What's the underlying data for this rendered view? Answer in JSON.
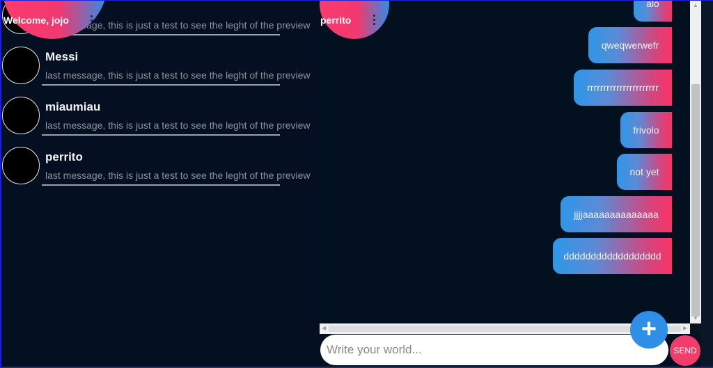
{
  "sidebar": {
    "welcome": "Welcome, jojo",
    "contacts": [
      {
        "name": "",
        "preview": "last message, this is just a test to see the leght of the preview"
      },
      {
        "name": "Messi",
        "preview": "last message, this is just a test to see the leght of the preview"
      },
      {
        "name": "miaumiau",
        "preview": "last message, this is just a test to see the leght of the preview"
      },
      {
        "name": "perrito",
        "preview": "last message, this is just a test to see the leght of the preview"
      }
    ]
  },
  "chat": {
    "title": "perrito",
    "messages": [
      {
        "text": "alo"
      },
      {
        "text": "qweqwerwefr"
      },
      {
        "text": "rrrrrrrrrrrrrrrrrrrrrr"
      },
      {
        "text": "frivolo"
      },
      {
        "text": "not yet"
      },
      {
        "text": "jjjjaaaaaaaaaaaaaa"
      },
      {
        "text": "dddddddddddddddddd"
      }
    ]
  },
  "composer": {
    "placeholder": "Write your world...",
    "send_label": "SEND",
    "add_label": "+"
  },
  "colors": {
    "background": "#041022",
    "accent_pink": "#fb3b6d",
    "accent_blue": "#2d8ee6"
  }
}
